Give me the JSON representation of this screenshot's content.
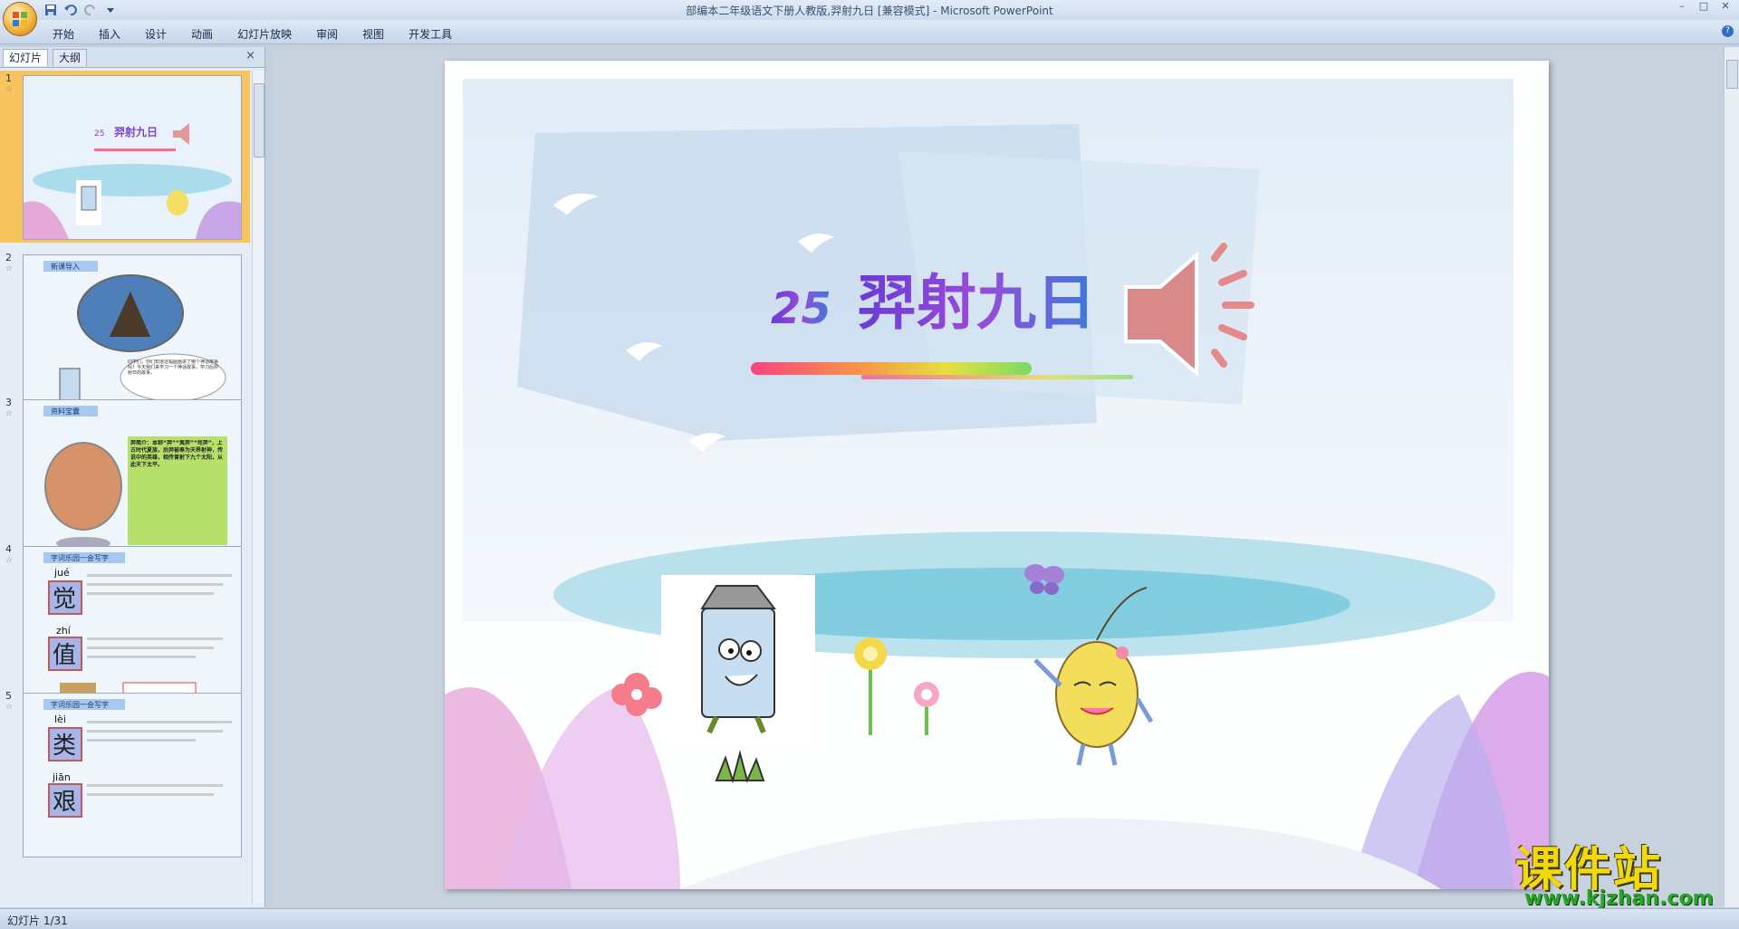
{
  "window": {
    "title": "部编本二年级语文下册人教版,羿射九日 [兼容模式] - Microsoft PowerPoint"
  },
  "ribbon": {
    "tabs": [
      "开始",
      "插入",
      "设计",
      "动画",
      "幻灯片放映",
      "审阅",
      "视图",
      "开发工具"
    ]
  },
  "left_pane": {
    "tab_slides": "幻灯片",
    "tab_outline": "大纲",
    "close": "×",
    "thumbnails": [
      {
        "num": "1",
        "title": "羿射九日",
        "lesson_no": "25"
      },
      {
        "num": "2",
        "title": "新课导入",
        "text": "同学们，你们知道这幅图画讲了哪个神话故事吗？今天我们来学习一个神话故事，学习后羿射日的故事。"
      },
      {
        "num": "3",
        "title": "资料宝囊",
        "text": "羿简介：本称“羿”“夷羿”“司羿”，上古时代夏族，后羿被奉为天界射神，传说中的英雄，相传曾射下九个太阳，从此天下太平。"
      },
      {
        "num": "4",
        "title": "字词乐园一会写字",
        "words": [
          {
            "pinyin": "jué",
            "char": "觉"
          },
          {
            "pinyin": "zhí",
            "char": "值"
          }
        ]
      },
      {
        "num": "5",
        "title": "字词乐园一会写字",
        "words": [
          {
            "pinyin": "lèi",
            "char": "类"
          },
          {
            "pinyin": "jiān",
            "char": "艰"
          }
        ]
      }
    ]
  },
  "slide": {
    "lesson_no": "25",
    "title": "羿射九日"
  },
  "status": {
    "slide_info": "幻灯片 1/31"
  },
  "watermark": {
    "line1": "课件站",
    "line2": "www.kjzhan.com"
  },
  "colors": {
    "accent": "#f4b33a",
    "ribbon": "#cddbee"
  }
}
